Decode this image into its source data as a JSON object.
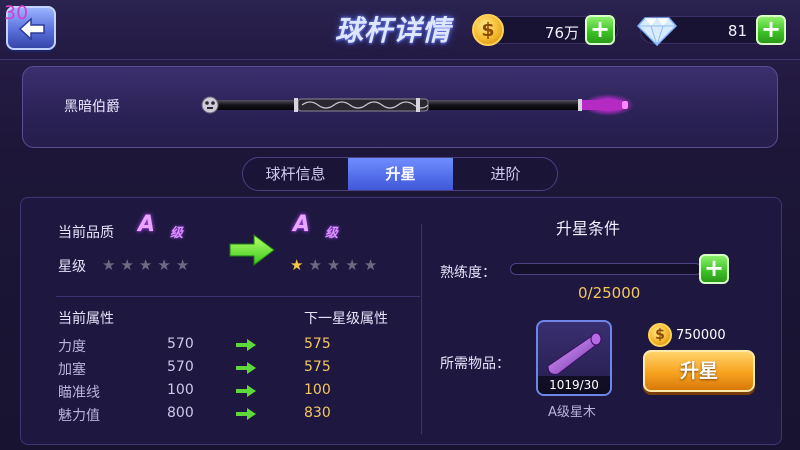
{
  "fps": "30",
  "header": {
    "title": "球杆详情",
    "coins": "76万",
    "diamonds": "81"
  },
  "cue": {
    "name": "黑暗伯爵"
  },
  "tabs": [
    {
      "label": "球杆信息",
      "active": false
    },
    {
      "label": "升星",
      "active": true
    },
    {
      "label": "进阶",
      "active": false
    }
  ],
  "left": {
    "quality_label": "当前品质",
    "grade_letter": "A",
    "grade_suffix": "级",
    "star_label": "星级",
    "current_stars": 0,
    "next_stars": 1,
    "max_stars": 5,
    "current_attr_header": "当前属性",
    "next_attr_header": "下一星级属性",
    "attributes": [
      {
        "name": "力度",
        "current": "570",
        "next": "575"
      },
      {
        "name": "加塞",
        "current": "570",
        "next": "575"
      },
      {
        "name": "瞄准线",
        "current": "100",
        "next": "100"
      },
      {
        "name": "魅力值",
        "current": "800",
        "next": "830"
      }
    ]
  },
  "right": {
    "condition_title": "升星条件",
    "proficiency_label": "熟练度：",
    "proficiency_value": "0/25000",
    "proficiency_fraction": 0,
    "items_label": "所需物品：",
    "item_count": "1019/30",
    "item_name": "A级星木",
    "cost": "750000",
    "upgrade_label": "升星"
  },
  "colors": {
    "accent": "#4058d9",
    "gold": "#f5c760",
    "grade_purple": "#e8a6ff",
    "green": "#3cbf26"
  }
}
